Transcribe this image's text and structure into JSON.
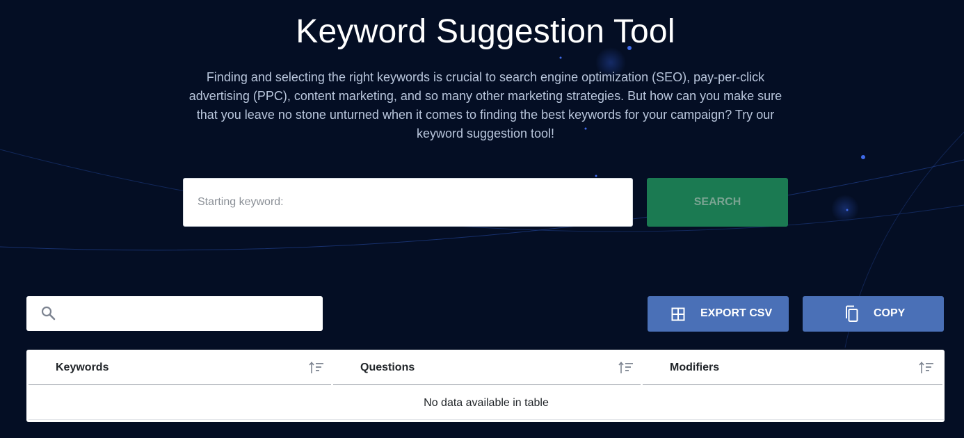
{
  "page": {
    "title": "Keyword Suggestion Tool",
    "description": "Finding and selecting the right keywords is crucial to search engine optimization (SEO), pay-per-click advertising (PPC), content marketing, and so many other marketing strategies. But how can you make sure that you leave no stone unturned when it comes to finding the best keywords for your campaign? Try our keyword suggestion tool!"
  },
  "search": {
    "placeholder": "Starting keyword:",
    "value": "",
    "button_label": "SEARCH"
  },
  "toolbar": {
    "filter_value": "",
    "export_label": "EXPORT CSV",
    "copy_label": "COPY"
  },
  "table": {
    "columns": [
      "Keywords",
      "Questions",
      "Modifiers"
    ],
    "rows": [],
    "empty_message": "No data available in table"
  },
  "icons": {
    "filter": "search-icon",
    "export": "grid-icon",
    "copy": "copy-icon",
    "sort": "sort-icon"
  },
  "colors": {
    "background": "#040e24",
    "search_button": "#1b7a52",
    "action_button": "#4a70b7"
  }
}
